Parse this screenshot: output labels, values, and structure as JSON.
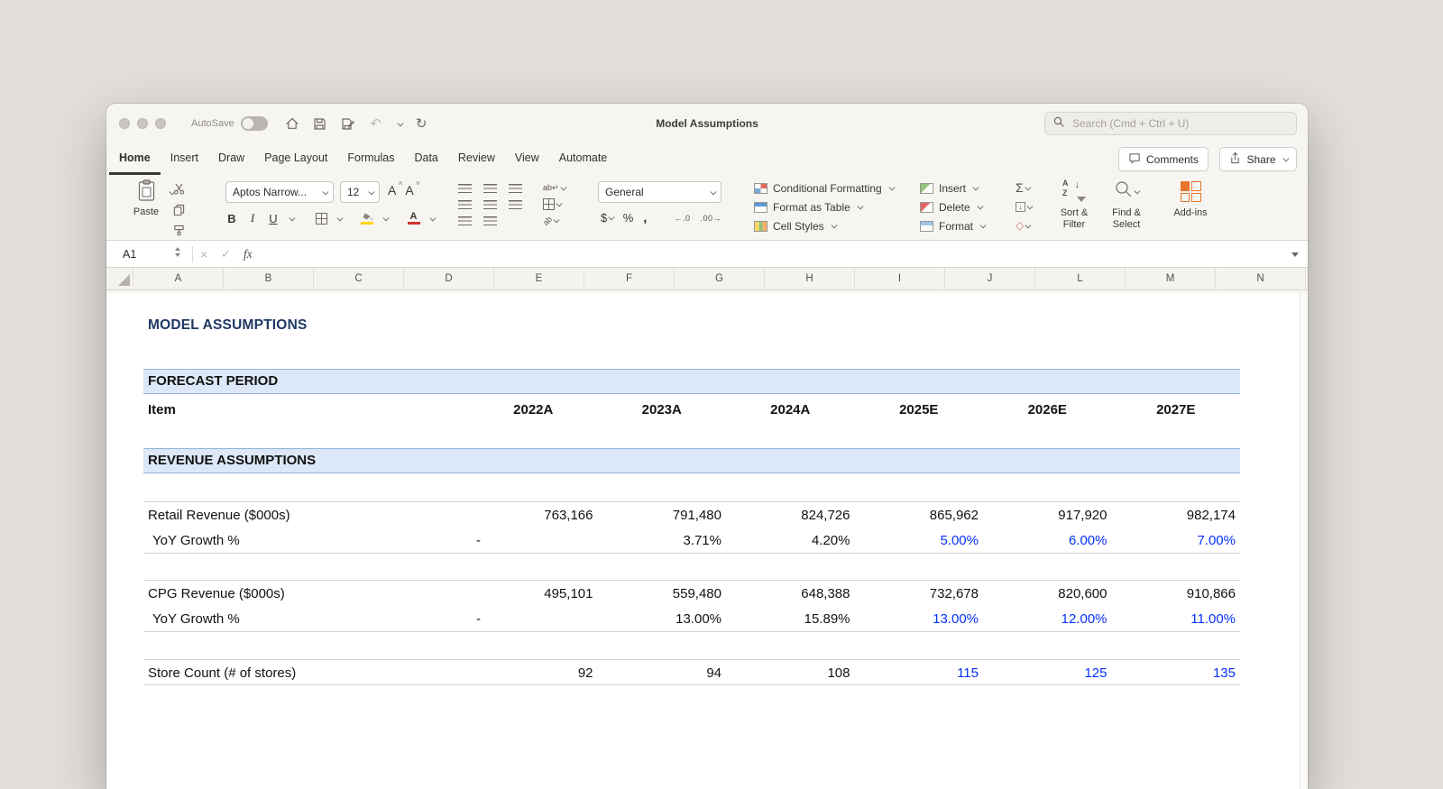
{
  "window": {
    "autosave": "AutoSave",
    "title": "Model Assumptions",
    "search_placeholder": "Search (Cmd + Ctrl + U)"
  },
  "tabs": [
    "Home",
    "Insert",
    "Draw",
    "Page Layout",
    "Formulas",
    "Data",
    "Review",
    "View",
    "Automate"
  ],
  "top_actions": {
    "comments": "Comments",
    "share": "Share"
  },
  "ribbon": {
    "paste": "Paste",
    "font_name": "Aptos Narrow...",
    "font_size": "12",
    "bold": "B",
    "italic": "I",
    "underline": "U",
    "grow_font": "A",
    "shrink_font": "A",
    "font_color_letter": "A",
    "number_format": "General",
    "currency": "$",
    "percent": "%",
    "comma": ",",
    "dec_left": "←.0",
    "dec_right": ".00→",
    "autosum": "Σ",
    "styles": [
      "Conditional Formatting",
      "Format as Table",
      "Cell Styles"
    ],
    "cells": [
      "Insert",
      "Delete",
      "Format"
    ],
    "sort_filter": [
      "Sort &",
      "Filter"
    ],
    "find_select": [
      "Find &",
      "Select"
    ],
    "sort_az": [
      "A",
      "Z"
    ],
    "addins": "Add-ins",
    "wrap_hint": "ab↵",
    "orient_hint": "ab"
  },
  "formula_bar": {
    "name_box": "A1",
    "fx": "fx"
  },
  "sheet": {
    "col_letters": [
      "A",
      "B",
      "C",
      "D",
      "E",
      "F",
      "G",
      "H",
      "I",
      "J",
      "L",
      "M",
      "N"
    ],
    "title": "MODEL ASSUMPTIONS",
    "sections": [
      "FORECAST PERIOD",
      "REVENUE ASSUMPTIONS"
    ],
    "item_label": "Item",
    "years": [
      "2022A",
      "2023A",
      "2024A",
      "2025E",
      "2026E",
      "2027E"
    ],
    "rows": [
      {
        "label": "Retail Revenue ($000s)",
        "values": [
          "763,166",
          "791,480",
          "824,726",
          "865,962",
          "917,920",
          "982,174"
        ]
      },
      {
        "label": "YoY Growth %",
        "values": [
          "-",
          "3.71%",
          "4.20%",
          "5.00%",
          "6.00%",
          "7.00%"
        ]
      },
      {
        "label": "CPG Revenue ($000s)",
        "values": [
          "495,101",
          "559,480",
          "648,388",
          "732,678",
          "820,600",
          "910,866"
        ]
      },
      {
        "label": "YoY Growth %",
        "values": [
          "-",
          "13.00%",
          "15.89%",
          "13.00%",
          "12.00%",
          "11.00%"
        ]
      },
      {
        "label": "Store Count (# of stores)",
        "values": [
          "92",
          "94",
          "108",
          "115",
          "125",
          "135"
        ]
      }
    ],
    "colors": {
      "title_navy": "#1f3864",
      "banner_bg": "#dce8f7",
      "estimate_blue": "#0532fa",
      "actual_black": "#000000"
    }
  }
}
